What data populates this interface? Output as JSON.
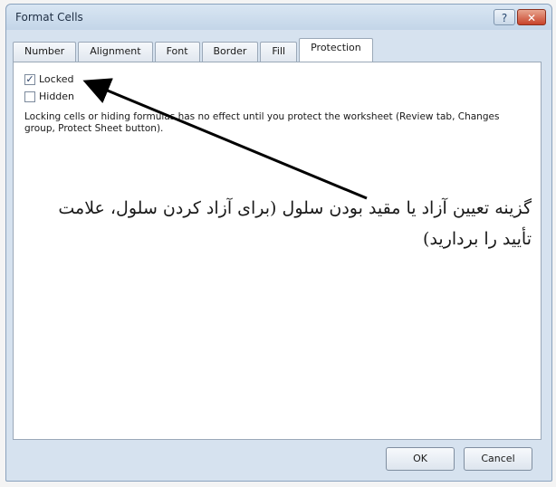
{
  "window": {
    "title": "Format Cells",
    "help_label": "?",
    "close_label": "✕"
  },
  "tabs": [
    {
      "label": "Number"
    },
    {
      "label": "Alignment"
    },
    {
      "label": "Font"
    },
    {
      "label": "Border"
    },
    {
      "label": "Fill"
    },
    {
      "label": "Protection",
      "active": true
    }
  ],
  "protection": {
    "locked": {
      "label": "Locked",
      "checked": true
    },
    "hidden": {
      "label": "Hidden",
      "checked": false
    },
    "note": "Locking cells or hiding formulas has no effect until you protect the worksheet (Review tab, Changes group, Protect Sheet button)."
  },
  "annotation": {
    "text": "گزینه تعیین آزاد یا مقید بودن سلول (برای آزاد کردن سلول، علامت تأیید را بردارید)"
  },
  "buttons": {
    "ok_label": "OK",
    "cancel_label": "Cancel"
  },
  "colors": {
    "titlebar": "#c3d5e8",
    "close_button": "#c8432a",
    "panel_bg": "#ffffff"
  }
}
